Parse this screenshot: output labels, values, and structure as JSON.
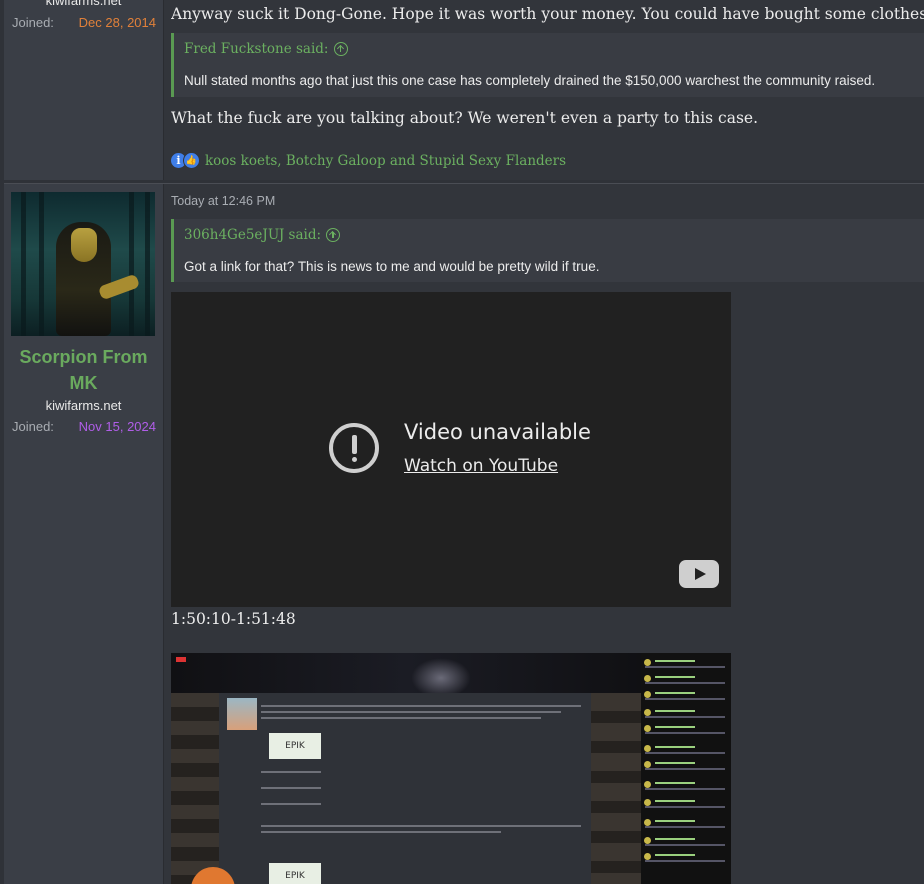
{
  "post1": {
    "site": "kiwifarms.net",
    "joined_label": "Joined:",
    "joined_date": "Dec 28, 2014",
    "joined_color": "#e0803a",
    "text1": "Anyway suck it Dong-Gone. Hope it was worth your money. You could have bought some clothes that",
    "quote": {
      "author": "Fred Fuckstone said:",
      "body": "Null stated months ago that just this one case has completely drained the $150,000 warchest the community raised."
    },
    "text2": "What the fuck are you talking about? We weren't even a party to this case.",
    "reactions": "koos koets, Botchy Galoop and Stupid Sexy Flanders"
  },
  "post2": {
    "user": {
      "name": "Scorpion From MK",
      "site": "kiwifarms.net",
      "joined_label": "Joined:",
      "joined_date": "Nov 15, 2024",
      "joined_color": "#b05ee8"
    },
    "timestamp": "Today at 12:46 PM",
    "quote": {
      "author": "306h4Ge5eJUJ said:",
      "body": "Got a link for that? This is news to me and would be pretty wild if true."
    },
    "video": {
      "title": "Video unavailable",
      "link": "Watch on YouTube"
    },
    "timecode": "1:50:10-1:51:48",
    "screenshot_logo": "EPIK"
  },
  "colors": {
    "accent_green": "#6bb060",
    "background": "#2f3238",
    "reaction_blue": "#3f7ee8"
  }
}
